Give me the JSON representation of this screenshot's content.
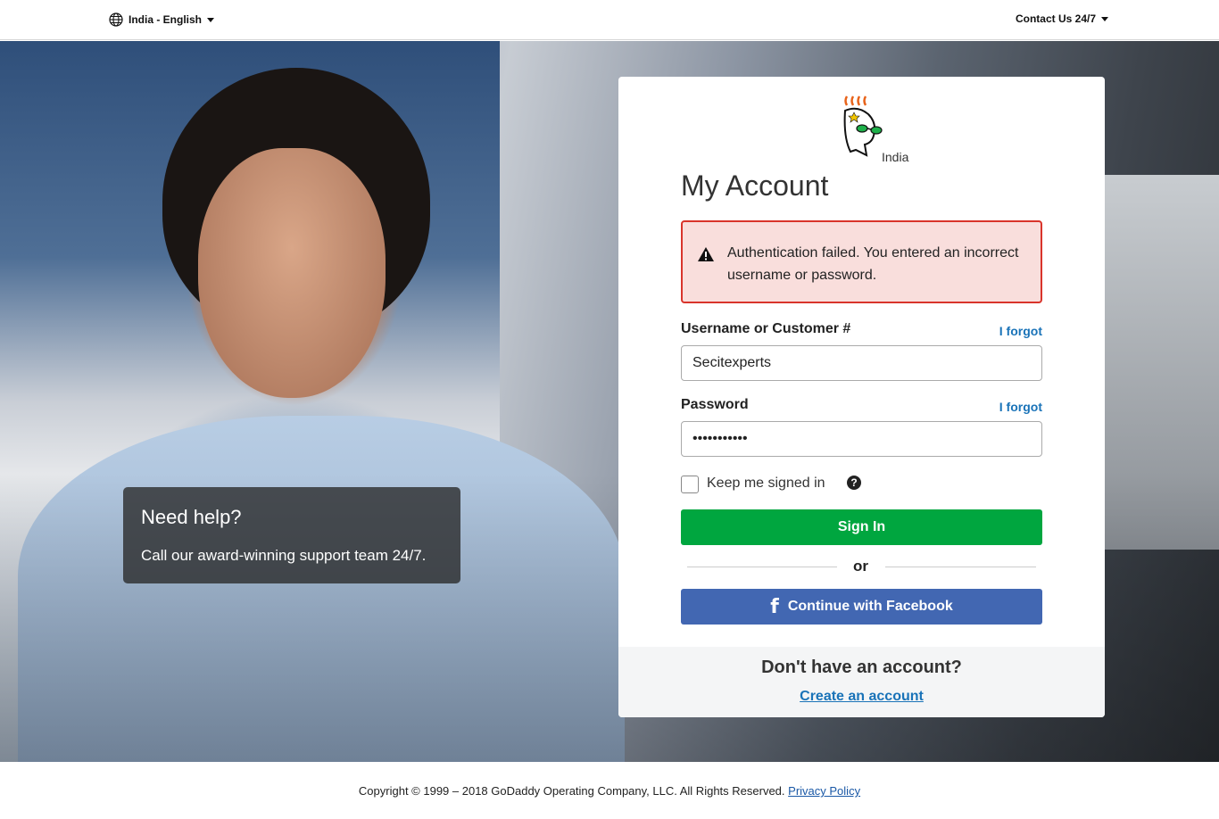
{
  "topbar": {
    "locale_label": "India - English",
    "contact_label": "Contact Us 24/7"
  },
  "help_box": {
    "title": "Need help?",
    "subtitle": "Call our award-winning support team 24/7."
  },
  "card": {
    "logo_region": "India",
    "title": "My Account",
    "alert_message": "Authentication failed. You entered an incorrect username or password.",
    "username_label": "Username or Customer #",
    "username_forgot": "I forgot",
    "username_value": "Secitexperts",
    "password_label": "Password",
    "password_forgot": "I forgot",
    "password_value": "•••••••••••",
    "keep_signed_in_label": "Keep me signed in",
    "help_icon_glyph": "?",
    "sign_in_label": "Sign In",
    "or_label": "or",
    "facebook_glyph": "f",
    "facebook_label": "Continue with Facebook",
    "no_account_question": "Don't have an account?",
    "create_account_label": "Create an account"
  },
  "footer": {
    "copyright": "Copyright © 1999 – 2018 GoDaddy Operating Company, LLC. All Rights Reserved.",
    "privacy_label": "Privacy Policy"
  },
  "colors": {
    "sign_in_green": "#00a63f",
    "facebook_blue": "#4267b2",
    "alert_red": "#d9342b",
    "alert_bg": "#f9dedc",
    "link_blue": "#1a73b8"
  }
}
